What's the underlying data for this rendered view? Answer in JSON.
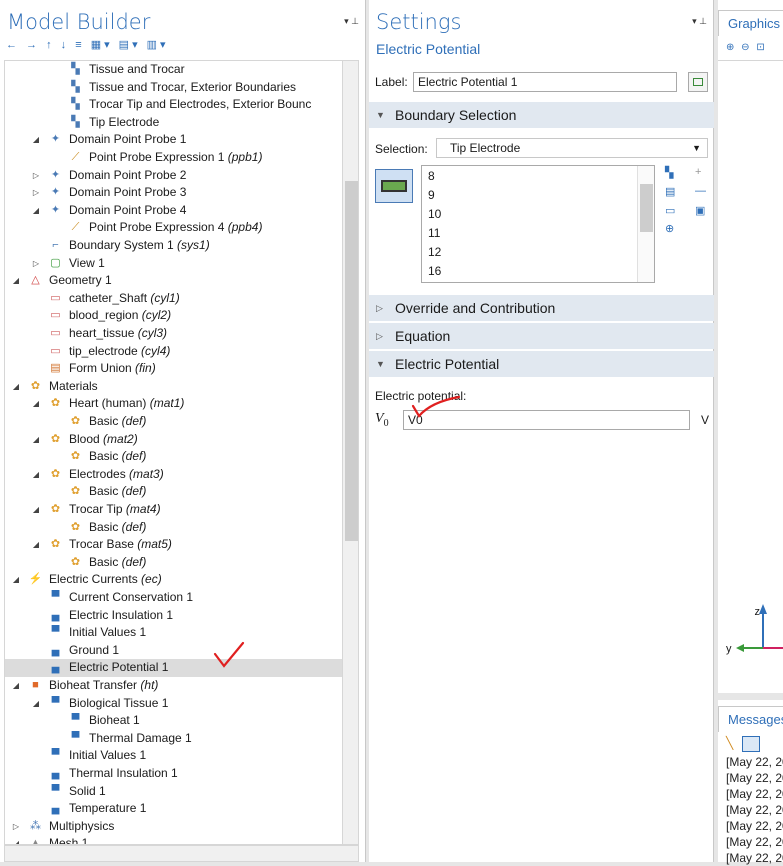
{
  "model_builder": {
    "title": "Model Builder",
    "pin_icons": "▾ ⊥",
    "toolbar_icons": "← → ↑ ↓ ≡ ▦▾ ▤▾ ▥▾",
    "tree": [
      {
        "label": "Tissue and Trocar",
        "tag": "",
        "icon": "selection-icon"
      },
      {
        "label": "Tissue and Trocar, Exterior Boundaries",
        "tag": "",
        "icon": "selection-icon"
      },
      {
        "label": "Trocar Tip and Electrodes, Exterior Bounc",
        "tag": "",
        "icon": "selection-icon"
      },
      {
        "label": "Tip Electrode",
        "tag": "",
        "icon": "selection-icon"
      },
      {
        "label": "Domain Point Probe 1",
        "tag": "",
        "icon": "probe-icon"
      },
      {
        "label": "Point Probe Expression 1",
        "tag": "(ppb1)",
        "icon": "probe-expression-icon"
      },
      {
        "label": "Domain Point Probe 2",
        "tag": "",
        "icon": "probe-icon"
      },
      {
        "label": "Domain Point Probe 3",
        "tag": "",
        "icon": "probe-icon"
      },
      {
        "label": "Domain Point Probe 4",
        "tag": "",
        "icon": "probe-icon"
      },
      {
        "label": "Point Probe Expression 4",
        "tag": "(ppb4)",
        "icon": "probe-expression-icon"
      },
      {
        "label": "Boundary System 1",
        "tag": "(sys1)",
        "icon": "coordinate-system-icon"
      },
      {
        "label": "View 1",
        "tag": "",
        "icon": "view-icon"
      },
      {
        "label": "Geometry 1",
        "tag": "",
        "icon": "geometry-icon"
      },
      {
        "label": "catheter_Shaft",
        "tag": "(cyl1)",
        "icon": "cylinder-icon"
      },
      {
        "label": "blood_region",
        "tag": "(cyl2)",
        "icon": "cylinder-icon"
      },
      {
        "label": "heart_tissue",
        "tag": "(cyl3)",
        "icon": "cylinder-icon"
      },
      {
        "label": "tip_electrode",
        "tag": "(cyl4)",
        "icon": "cylinder-icon"
      },
      {
        "label": "Form Union",
        "tag": "(fin)",
        "icon": "form-union-icon"
      },
      {
        "label": "Materials",
        "tag": "",
        "icon": "materials-icon"
      },
      {
        "label": "Heart (human)",
        "tag": "(mat1)",
        "icon": "material-icon"
      },
      {
        "label": "Basic",
        "tag": "(def)",
        "icon": "material-icon"
      },
      {
        "label": "Blood",
        "tag": "(mat2)",
        "icon": "material-icon"
      },
      {
        "label": "Basic",
        "tag": "(def)",
        "icon": "material-icon"
      },
      {
        "label": "Electrodes",
        "tag": "(mat3)",
        "icon": "material-icon"
      },
      {
        "label": "Basic",
        "tag": "(def)",
        "icon": "material-icon"
      },
      {
        "label": "Trocar Tip",
        "tag": "(mat4)",
        "icon": "material-icon"
      },
      {
        "label": "Basic",
        "tag": "(def)",
        "icon": "material-icon"
      },
      {
        "label": "Trocar Base",
        "tag": "(mat5)",
        "icon": "material-icon"
      },
      {
        "label": "Basic",
        "tag": "(def)",
        "icon": "material-icon"
      },
      {
        "label": "Electric Currents",
        "tag": "(ec)",
        "icon": "electric-currents-icon"
      },
      {
        "label": "Current Conservation 1",
        "tag": "",
        "icon": "domain-feature-icon"
      },
      {
        "label": "Electric Insulation 1",
        "tag": "",
        "icon": "boundary-feature-icon"
      },
      {
        "label": "Initial Values 1",
        "tag": "",
        "icon": "domain-feature-icon"
      },
      {
        "label": "Ground 1",
        "tag": "",
        "icon": "boundary-feature-icon"
      },
      {
        "label": "Electric Potential 1",
        "tag": "",
        "icon": "boundary-feature-icon"
      },
      {
        "label": "Bioheat Transfer",
        "tag": "(ht)",
        "icon": "bioheat-icon"
      },
      {
        "label": "Biological Tissue 1",
        "tag": "",
        "icon": "domain-feature-icon"
      },
      {
        "label": "Bioheat 1",
        "tag": "",
        "icon": "domain-feature-icon"
      },
      {
        "label": "Thermal Damage 1",
        "tag": "",
        "icon": "domain-feature-icon"
      },
      {
        "label": "Initial Values 1",
        "tag": "",
        "icon": "domain-feature-icon"
      },
      {
        "label": "Thermal Insulation 1",
        "tag": "",
        "icon": "boundary-feature-icon"
      },
      {
        "label": "Solid 1",
        "tag": "",
        "icon": "domain-feature-icon"
      },
      {
        "label": "Temperature 1",
        "tag": "",
        "icon": "boundary-feature-icon"
      },
      {
        "label": "Multiphysics",
        "tag": "",
        "icon": "multiphysics-icon"
      },
      {
        "label": "Mesh 1",
        "tag": "",
        "icon": "mesh-icon"
      }
    ],
    "selected_label": "Electric Potential 1"
  },
  "settings": {
    "title": "Settings",
    "subtitle": "Electric Potential",
    "label_caption": "Label:",
    "label_value": "Electric Potential 1",
    "boundary_section": "Boundary Selection",
    "selection_caption": "Selection:",
    "selection_value": "Tip Electrode",
    "boundaries": [
      "8",
      "9",
      "10",
      "11",
      "12",
      "16"
    ],
    "sections": {
      "override": "Override and Contribution",
      "equation": "Equation",
      "potential": "Electric Potential"
    },
    "potential_caption": "Electric potential:",
    "potential_symbol": "V",
    "potential_subscript": "0",
    "potential_value": "V0",
    "potential_unit": "V"
  },
  "graphics": {
    "title": "Graphics",
    "toolbar_icons": "⊕ ⊖ ⊡",
    "axis_z": "z",
    "axis_y": "y"
  },
  "messages": {
    "title": "Messages",
    "lines": [
      "[May 22, 20",
      "[May 22, 20",
      "[May 22, 20",
      "[May 22, 20",
      "[May 22, 20",
      "[May 22, 20",
      "[May 22, 20"
    ]
  },
  "colors": {
    "accent": "#2f6fb8",
    "section_bg": "#e1e8f0",
    "selected_row": "#dcdcdc",
    "annotation": "#e02020"
  }
}
